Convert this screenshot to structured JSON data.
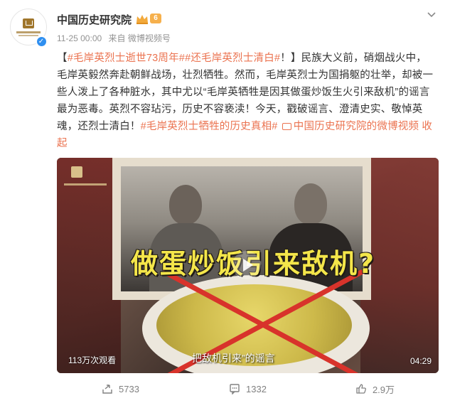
{
  "author": {
    "name": "中国历史研究院",
    "level_badge": "6",
    "avatar_text": "中国历史研究院"
  },
  "meta": {
    "time": "11-25 00:00",
    "source": "来自 微博视频号"
  },
  "post": {
    "open_bracket": "【",
    "tag1": "#毛岸英烈士逝世73周年#",
    "tag2": "#还毛岸英烈士清白#",
    "text1": "！】民族大义前，硝烟战火中，毛岸英毅然奔赴朝鲜战场，壮烈牺牲。然而，毛岸英烈士为国捐躯的壮举，却被一些人泼上了各种脏水，其中尤以“毛岸英牺牲是因其做蛋炒饭生火引来敌机”的谣言最为恶毒。英烈不容玷污，历史不容亵渎！今天，戳破谣言、澄清史实、敬悼英魂，还烈士清白！",
    "tag3": "#毛岸英烈士牺牲的历史真相#",
    "video_link": "中国历史研究院的微博视频",
    "collapse": "收起"
  },
  "video": {
    "caption": "做蛋炒饭引来敌机?",
    "subtitle": "把敌机引来”的谣言",
    "views": "113万次观看",
    "duration": "04:29"
  },
  "actions": {
    "share": "5733",
    "comment": "1332",
    "like": "2.9万"
  }
}
